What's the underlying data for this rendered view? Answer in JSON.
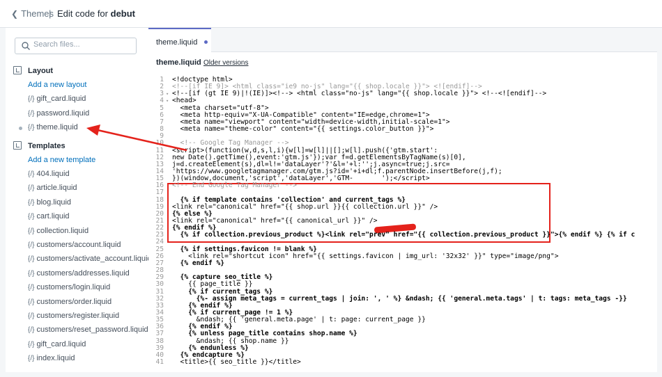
{
  "topbar": {
    "back_label": "Themes",
    "separator": "|",
    "title_prefix": "Edit code for",
    "theme_name": "debut"
  },
  "search": {
    "placeholder": "Search files..."
  },
  "sidebar": {
    "layout": {
      "title": "Layout",
      "add": "Add a new layout",
      "files": [
        "gift_card.liquid",
        "password.liquid",
        "theme.liquid"
      ]
    },
    "templates": {
      "title": "Templates",
      "add": "Add a new template",
      "files": [
        "404.liquid",
        "article.liquid",
        "blog.liquid",
        "cart.liquid",
        "collection.liquid",
        "customers/account.liquid",
        "customers/activate_account.liquid",
        "customers/addresses.liquid",
        "customers/login.liquid",
        "customers/order.liquid",
        "customers/register.liquid",
        "customers/reset_password.liquid",
        "gift_card.liquid",
        "index.liquid"
      ]
    },
    "file_icon": "{/}"
  },
  "editor": {
    "tab": "theme.liquid",
    "filename": "theme.liquid",
    "older_versions": "Older versions",
    "lines": [
      {
        "n": "1",
        "fold": "",
        "text": "<!doctype html>",
        "color": "#000"
      },
      {
        "n": "2",
        "fold": "",
        "text": "<!--[if IE 9]> <html class=\"ie9 no-js\" lang=\"{{ shop.locale }}\"> <![endif]-->",
        "color": "#999"
      },
      {
        "n": "3",
        "fold": "▾",
        "text": "<!--[if (gt IE 9)|!(IE)]><!--> <html class=\"no-js\" lang=\"{{ shop.locale }}\"> <!--<![endif]-->",
        "color": "#000"
      },
      {
        "n": "4",
        "fold": "▾",
        "text": "<head>",
        "color": "#000"
      },
      {
        "n": "5",
        "fold": "",
        "text": "  <meta charset=\"utf-8\">",
        "color": "#000"
      },
      {
        "n": "6",
        "fold": "",
        "text": "  <meta http-equiv=\"X-UA-Compatible\" content=\"IE=edge,chrome=1\">",
        "color": "#000"
      },
      {
        "n": "7",
        "fold": "",
        "text": "  <meta name=\"viewport\" content=\"width=device-width,initial-scale=1\">",
        "color": "#000"
      },
      {
        "n": "8",
        "fold": "",
        "text": "  <meta name=\"theme-color\" content=\"{{ settings.color_button }}\">",
        "color": "#000"
      },
      {
        "n": "9",
        "fold": "",
        "text": "",
        "color": "#000"
      },
      {
        "n": "10",
        "fold": "",
        "text": "  <!-- Google Tag Manager -->",
        "color": "#999"
      },
      {
        "n": "11",
        "fold": "",
        "text": "<script>(function(w,d,s,l,i){w[l]=w[l]||[];w[l].push({'gtm.start':",
        "color": "#000"
      },
      {
        "n": "12",
        "fold": "",
        "text": "new Date().getTime(),event:'gtm.js'});var f=d.getElementsByTagName(s)[0],",
        "color": "#000"
      },
      {
        "n": "13",
        "fold": "",
        "text": "j=d.createElement(s),dl=l!='dataLayer'?'&l='+l:'';j.async=true;j.src=",
        "color": "#000"
      },
      {
        "n": "14",
        "fold": "",
        "text": "'https://www.googletagmanager.com/gtm.js?id='+i+dl;f.parentNode.insertBefore(j,f);",
        "color": "#000"
      },
      {
        "n": "15",
        "fold": "",
        "text": "})(window,document,'script','dataLayer','GTM-       ');</script>",
        "color": "#000"
      },
      {
        "n": "16",
        "fold": "",
        "text": "<!-- End Google Tag Manager -->",
        "color": "#999"
      },
      {
        "n": "17",
        "fold": "",
        "text": "",
        "color": "#000"
      },
      {
        "n": "18",
        "fold": "",
        "text": "  {% if template contains 'collection' and current_tags %}",
        "color": "#000"
      },
      {
        "n": "19",
        "fold": "",
        "text": "<link rel=\"canonical\" href=\"{{ shop.url }}{{ collection.url }}\" />",
        "color": "#000"
      },
      {
        "n": "20",
        "fold": "",
        "text": "{% else %}",
        "color": "#000"
      },
      {
        "n": "21",
        "fold": "",
        "text": "<link rel=\"canonical\" href=\"{{ canonical_url }}\" />",
        "color": "#000"
      },
      {
        "n": "22",
        "fold": "",
        "text": "{% endif %}",
        "color": "#000"
      },
      {
        "n": "23",
        "fold": "",
        "text": "  {% if collection.previous_product %}<link rel=\"prev\" href=\"{{ collection.previous_product }}\">{% endif %} {% if c",
        "color": "#000"
      },
      {
        "n": "24",
        "fold": "",
        "text": "",
        "color": "#000"
      },
      {
        "n": "25",
        "fold": "",
        "text": "  {% if settings.favicon != blank %}",
        "color": "#000"
      },
      {
        "n": "26",
        "fold": "",
        "text": "    <link rel=\"shortcut icon\" href=\"{{ settings.favicon | img_url: '32x32' }}\" type=\"image/png\">",
        "color": "#000"
      },
      {
        "n": "27",
        "fold": "",
        "text": "  {% endif %}",
        "color": "#000"
      },
      {
        "n": "28",
        "fold": "",
        "text": "",
        "color": "#000"
      },
      {
        "n": "29",
        "fold": "",
        "text": "  {% capture seo_title %}",
        "color": "#000"
      },
      {
        "n": "30",
        "fold": "",
        "text": "    {{ page_title }}",
        "color": "#000"
      },
      {
        "n": "31",
        "fold": "",
        "text": "    {% if current_tags %}",
        "color": "#000"
      },
      {
        "n": "32",
        "fold": "",
        "text": "      {%- assign meta_tags = current_tags | join: ', ' %} &ndash; {{ 'general.meta.tags' | t: tags: meta_tags -}}",
        "color": "#000"
      },
      {
        "n": "33",
        "fold": "",
        "text": "    {% endif %}",
        "color": "#000"
      },
      {
        "n": "34",
        "fold": "",
        "text": "    {% if current_page != 1 %}",
        "color": "#000"
      },
      {
        "n": "35",
        "fold": "",
        "text": "      &ndash; {{ 'general.meta.page' | t: page: current_page }}",
        "color": "#000"
      },
      {
        "n": "36",
        "fold": "",
        "text": "    {% endif %}",
        "color": "#000"
      },
      {
        "n": "37",
        "fold": "",
        "text": "    {% unless page_title contains shop.name %}",
        "color": "#000"
      },
      {
        "n": "38",
        "fold": "",
        "text": "      &ndash; {{ shop.name }}",
        "color": "#000"
      },
      {
        "n": "39",
        "fold": "",
        "text": "    {% endunless %}",
        "color": "#000"
      },
      {
        "n": "40",
        "fold": "",
        "text": "  {% endcapture %}",
        "color": "#000"
      },
      {
        "n": "41",
        "fold": "",
        "text": "  <title>{{ seo_title }}</title>",
        "color": "#000"
      }
    ]
  },
  "colors": {
    "accent": "#5c6ac4",
    "link": "#006fbb",
    "highlight": "#e4221b"
  }
}
